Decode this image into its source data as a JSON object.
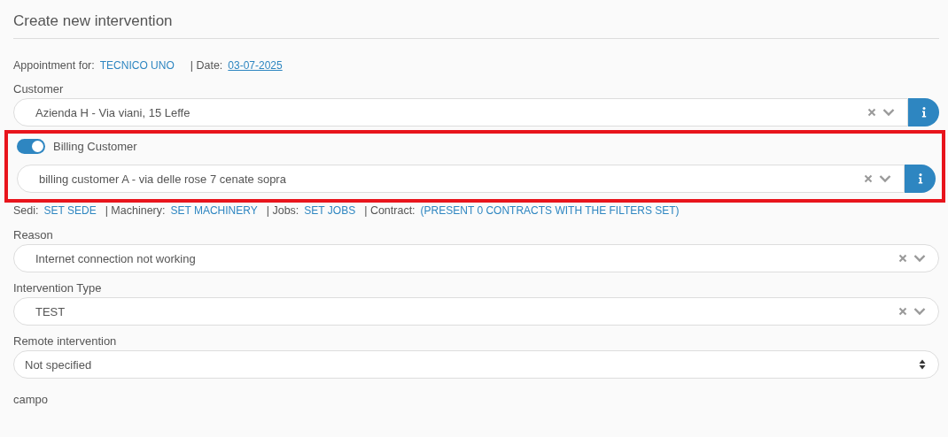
{
  "title": "Create new intervention",
  "appointment": {
    "label": "Appointment for:",
    "technician": "TECNICO UNO",
    "date_label": "| Date:",
    "date": "03-07-2025"
  },
  "customer": {
    "label": "Customer",
    "value": "Azienda H - Via viani, 15 Leffe"
  },
  "billing": {
    "on": true,
    "highlighted": true,
    "label": "Billing Customer",
    "value": "billing customer A - via delle rose 7 cenate sopra"
  },
  "links": [
    {
      "label": "Sedi:",
      "value": "SET SEDE"
    },
    {
      "label": "| Machinery:",
      "value": "SET MACHINERY"
    },
    {
      "label": "| Jobs:",
      "value": "SET JOBS"
    },
    {
      "label": "| Contract:",
      "value": "(PRESENT 0 CONTRACTS WITH THE FILTERS SET)"
    }
  ],
  "fields": [
    {
      "label": "Reason",
      "value": "Internet connection not working",
      "kind": "combo"
    },
    {
      "label": "Intervention Type",
      "value": "TEST",
      "kind": "combo"
    },
    {
      "label": "Remote intervention",
      "value": "Not specified",
      "kind": "native"
    }
  ],
  "next_label": "campo"
}
